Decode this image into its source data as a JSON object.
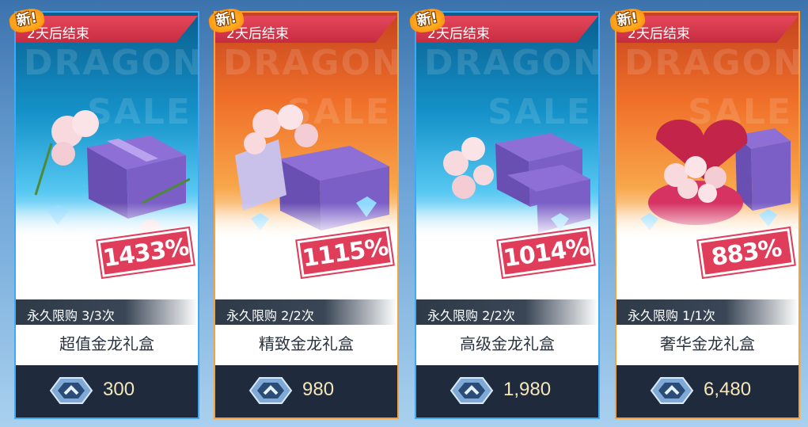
{
  "cards": [
    {
      "new_label": "新!",
      "banner": "2天后结束",
      "bonus": "1433%",
      "limit": "永久限购 3/3次",
      "name": "超值金龙礼盒",
      "price": "300",
      "theme": "blue"
    },
    {
      "new_label": "新!",
      "banner": "2天后结束",
      "bonus": "1115%",
      "limit": "永久限购 2/2次",
      "name": "精致金龙礼盒",
      "price": "980",
      "theme": "orange"
    },
    {
      "new_label": "新!",
      "banner": "2天后结束",
      "bonus": "1014%",
      "limit": "永久限购 2/2次",
      "name": "高级金龙礼盒",
      "price": "1,980",
      "theme": "blue"
    },
    {
      "new_label": "新!",
      "banner": "2天后结束",
      "bonus": "883%",
      "limit": "永久限购 1/1次",
      "name": "奢华金龙礼盒",
      "price": "6,480",
      "theme": "orange"
    }
  ],
  "watermark": {
    "line1": "DRAGON",
    "line2": "SALE"
  },
  "icons": {
    "currency": "gem-currency-icon",
    "illustration": "gift-box-flowers-illustration"
  },
  "colors": {
    "blue_border": "#3fa9f5",
    "orange_border": "#f6a13a",
    "stamp": "#df3d5a",
    "banner": "#d43a4e",
    "price": "#f4e6b8"
  }
}
